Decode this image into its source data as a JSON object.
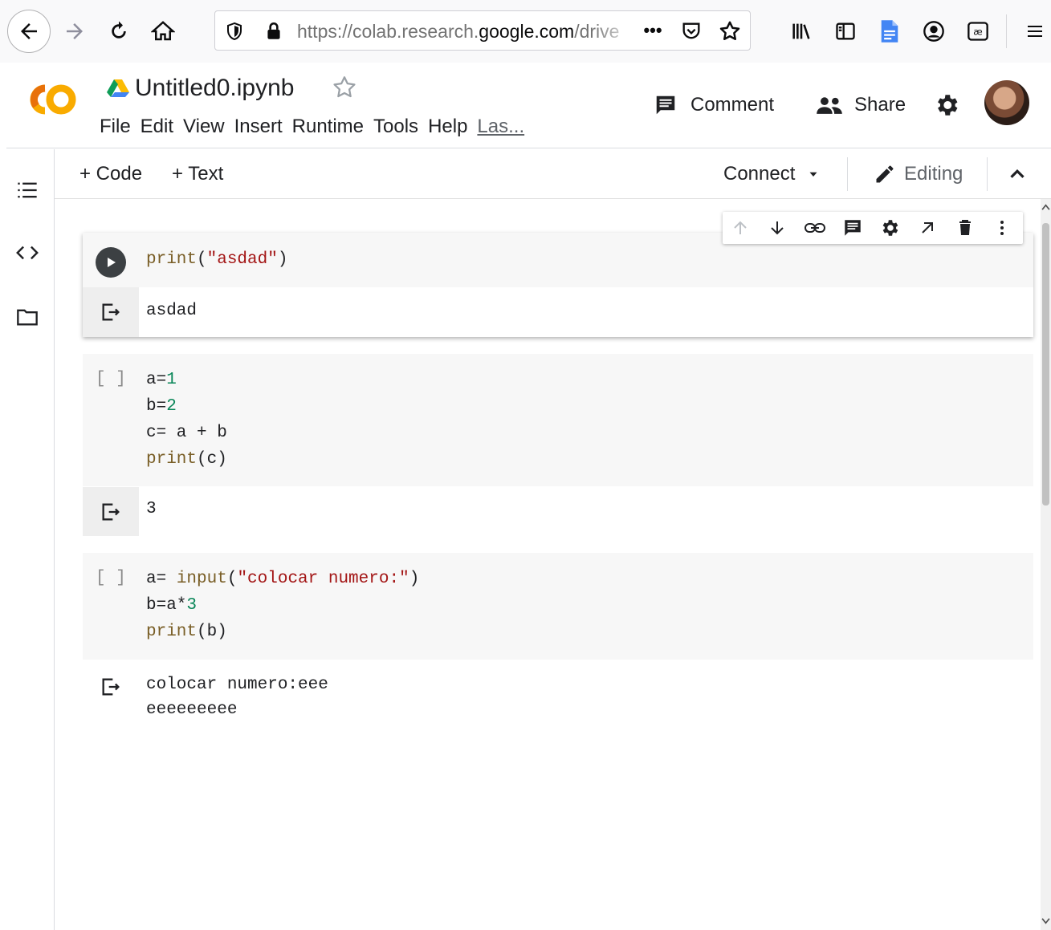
{
  "browser": {
    "url_prefix": "https://colab.research.",
    "url_domain": "google.com",
    "url_suffix": "/drive",
    "more_label": "•••"
  },
  "header": {
    "file_name": "Untitled0.ipynb",
    "menu": [
      "File",
      "Edit",
      "View",
      "Insert",
      "Runtime",
      "Tools",
      "Help",
      "Las..."
    ],
    "comment_label": "Comment",
    "share_label": "Share"
  },
  "toolbar": {
    "add_code_label": "+ Code",
    "add_text_label": "+ Text",
    "connect_label": "Connect",
    "editing_label": "Editing"
  },
  "cells": [
    {
      "exec_count": "",
      "code": [
        "print(\"asdad\")"
      ],
      "output": [
        "asdad"
      ]
    },
    {
      "exec_count": "[ ]",
      "code": [
        "a=1",
        "b=2",
        "c= a + b",
        "print(c)"
      ],
      "output": [
        "3"
      ]
    },
    {
      "exec_count": "[ ]",
      "code": [
        "a= input(\"colocar numero:\")",
        "b=a*3",
        "print(b)"
      ],
      "output": [
        "colocar numero:eee",
        "eeeeeeeee"
      ]
    }
  ],
  "icons": {
    "browser": [
      "back-arrow-icon",
      "forward-arrow-icon",
      "reload-icon",
      "home-icon",
      "shield-icon",
      "lock-icon",
      "more-icon",
      "pocket-icon",
      "bookmark-star-icon",
      "library-icon",
      "sidebar-icon",
      "document-icon",
      "account-icon",
      "extension-icon",
      "hamburger-menu-icon"
    ],
    "colab": [
      "colab-logo",
      "drive-icon",
      "star-icon",
      "comment-icon",
      "share-people-icon",
      "gear-icon",
      "toc-icon",
      "code-snippets-icon",
      "folder-icon",
      "run-icon",
      "output-icon"
    ],
    "cell_toolbar": [
      "move-up-icon",
      "move-down-icon",
      "link-icon",
      "comment-icon",
      "gear-icon",
      "open-external-icon",
      "delete-icon",
      "more-vert-icon"
    ]
  },
  "colors": {
    "colab_orange": "#f9ab00",
    "colab_yellow": "#e8710a",
    "keyword": "#795e26",
    "string": "#a31515",
    "number": "#098658"
  }
}
